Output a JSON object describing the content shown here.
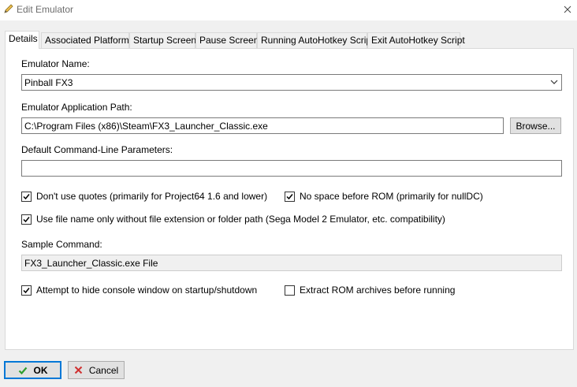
{
  "window": {
    "title": "Edit Emulator",
    "close_icon": "close-icon",
    "title_icon": "pencil-icon"
  },
  "tabs": [
    {
      "label": "Details",
      "active": true
    },
    {
      "label": "Associated Platforms",
      "active": false
    },
    {
      "label": "Startup Screen",
      "active": false
    },
    {
      "label": "Pause Screen",
      "active": false
    },
    {
      "label": "Running AutoHotkey Script",
      "active": false
    },
    {
      "label": "Exit AutoHotkey Script",
      "active": false
    }
  ],
  "details": {
    "emulator_name_label": "Emulator Name:",
    "emulator_name_value": "Pinball FX3",
    "app_path_label": "Emulator Application Path:",
    "app_path_value": "C:\\Program Files (x86)\\Steam\\FX3_Launcher_Classic.exe",
    "browse_label": "Browse...",
    "cmd_params_label": "Default Command-Line Parameters:",
    "cmd_params_value": "",
    "no_quotes_label": "Don't use quotes (primarily for Project64 1.6 and lower)",
    "no_quotes_checked": true,
    "no_space_label": "No space before ROM (primarily for nullDC)",
    "no_space_checked": true,
    "filename_only_label": "Use file name only without file extension or folder path (Sega Model 2 Emulator, etc. compatibility)",
    "filename_only_checked": true,
    "sample_command_label": "Sample Command:",
    "sample_command_value": "FX3_Launcher_Classic.exe File",
    "hide_console_label": "Attempt to hide console window on startup/shutdown",
    "hide_console_checked": true,
    "extract_rom_label": "Extract ROM archives before running",
    "extract_rom_checked": false
  },
  "footer": {
    "ok_label": "OK",
    "cancel_label": "Cancel"
  },
  "colors": {
    "ok_border": "#0078d7",
    "ok_check": "#2e9e2e",
    "cancel_x": "#d03030"
  }
}
